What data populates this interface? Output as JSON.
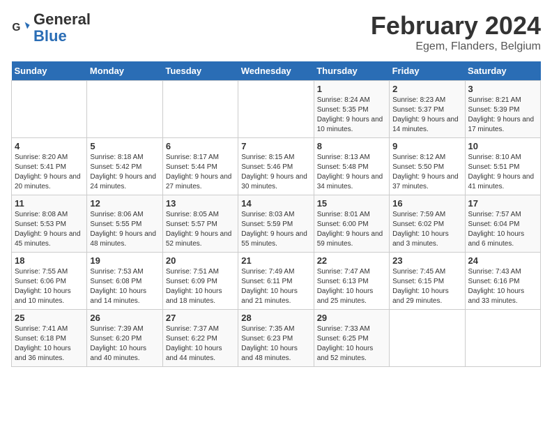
{
  "header": {
    "logo_text_general": "General",
    "logo_text_blue": "Blue",
    "main_title": "February 2024",
    "subtitle": "Egem, Flanders, Belgium"
  },
  "calendar": {
    "days_of_week": [
      "Sunday",
      "Monday",
      "Tuesday",
      "Wednesday",
      "Thursday",
      "Friday",
      "Saturday"
    ],
    "weeks": [
      [
        {
          "day": "",
          "info": ""
        },
        {
          "day": "",
          "info": ""
        },
        {
          "day": "",
          "info": ""
        },
        {
          "day": "",
          "info": ""
        },
        {
          "day": "1",
          "info": "Sunrise: 8:24 AM\nSunset: 5:35 PM\nDaylight: 9 hours\nand 10 minutes."
        },
        {
          "day": "2",
          "info": "Sunrise: 8:23 AM\nSunset: 5:37 PM\nDaylight: 9 hours\nand 14 minutes."
        },
        {
          "day": "3",
          "info": "Sunrise: 8:21 AM\nSunset: 5:39 PM\nDaylight: 9 hours\nand 17 minutes."
        }
      ],
      [
        {
          "day": "4",
          "info": "Sunrise: 8:20 AM\nSunset: 5:41 PM\nDaylight: 9 hours\nand 20 minutes."
        },
        {
          "day": "5",
          "info": "Sunrise: 8:18 AM\nSunset: 5:42 PM\nDaylight: 9 hours\nand 24 minutes."
        },
        {
          "day": "6",
          "info": "Sunrise: 8:17 AM\nSunset: 5:44 PM\nDaylight: 9 hours\nand 27 minutes."
        },
        {
          "day": "7",
          "info": "Sunrise: 8:15 AM\nSunset: 5:46 PM\nDaylight: 9 hours\nand 30 minutes."
        },
        {
          "day": "8",
          "info": "Sunrise: 8:13 AM\nSunset: 5:48 PM\nDaylight: 9 hours\nand 34 minutes."
        },
        {
          "day": "9",
          "info": "Sunrise: 8:12 AM\nSunset: 5:50 PM\nDaylight: 9 hours\nand 37 minutes."
        },
        {
          "day": "10",
          "info": "Sunrise: 8:10 AM\nSunset: 5:51 PM\nDaylight: 9 hours\nand 41 minutes."
        }
      ],
      [
        {
          "day": "11",
          "info": "Sunrise: 8:08 AM\nSunset: 5:53 PM\nDaylight: 9 hours\nand 45 minutes."
        },
        {
          "day": "12",
          "info": "Sunrise: 8:06 AM\nSunset: 5:55 PM\nDaylight: 9 hours\nand 48 minutes."
        },
        {
          "day": "13",
          "info": "Sunrise: 8:05 AM\nSunset: 5:57 PM\nDaylight: 9 hours\nand 52 minutes."
        },
        {
          "day": "14",
          "info": "Sunrise: 8:03 AM\nSunset: 5:59 PM\nDaylight: 9 hours\nand 55 minutes."
        },
        {
          "day": "15",
          "info": "Sunrise: 8:01 AM\nSunset: 6:00 PM\nDaylight: 9 hours\nand 59 minutes."
        },
        {
          "day": "16",
          "info": "Sunrise: 7:59 AM\nSunset: 6:02 PM\nDaylight: 10 hours\nand 3 minutes."
        },
        {
          "day": "17",
          "info": "Sunrise: 7:57 AM\nSunset: 6:04 PM\nDaylight: 10 hours\nand 6 minutes."
        }
      ],
      [
        {
          "day": "18",
          "info": "Sunrise: 7:55 AM\nSunset: 6:06 PM\nDaylight: 10 hours\nand 10 minutes."
        },
        {
          "day": "19",
          "info": "Sunrise: 7:53 AM\nSunset: 6:08 PM\nDaylight: 10 hours\nand 14 minutes."
        },
        {
          "day": "20",
          "info": "Sunrise: 7:51 AM\nSunset: 6:09 PM\nDaylight: 10 hours\nand 18 minutes."
        },
        {
          "day": "21",
          "info": "Sunrise: 7:49 AM\nSunset: 6:11 PM\nDaylight: 10 hours\nand 21 minutes."
        },
        {
          "day": "22",
          "info": "Sunrise: 7:47 AM\nSunset: 6:13 PM\nDaylight: 10 hours\nand 25 minutes."
        },
        {
          "day": "23",
          "info": "Sunrise: 7:45 AM\nSunset: 6:15 PM\nDaylight: 10 hours\nand 29 minutes."
        },
        {
          "day": "24",
          "info": "Sunrise: 7:43 AM\nSunset: 6:16 PM\nDaylight: 10 hours\nand 33 minutes."
        }
      ],
      [
        {
          "day": "25",
          "info": "Sunrise: 7:41 AM\nSunset: 6:18 PM\nDaylight: 10 hours\nand 36 minutes."
        },
        {
          "day": "26",
          "info": "Sunrise: 7:39 AM\nSunset: 6:20 PM\nDaylight: 10 hours\nand 40 minutes."
        },
        {
          "day": "27",
          "info": "Sunrise: 7:37 AM\nSunset: 6:22 PM\nDaylight: 10 hours\nand 44 minutes."
        },
        {
          "day": "28",
          "info": "Sunrise: 7:35 AM\nSunset: 6:23 PM\nDaylight: 10 hours\nand 48 minutes."
        },
        {
          "day": "29",
          "info": "Sunrise: 7:33 AM\nSunset: 6:25 PM\nDaylight: 10 hours\nand 52 minutes."
        },
        {
          "day": "",
          "info": ""
        },
        {
          "day": "",
          "info": ""
        }
      ]
    ]
  }
}
